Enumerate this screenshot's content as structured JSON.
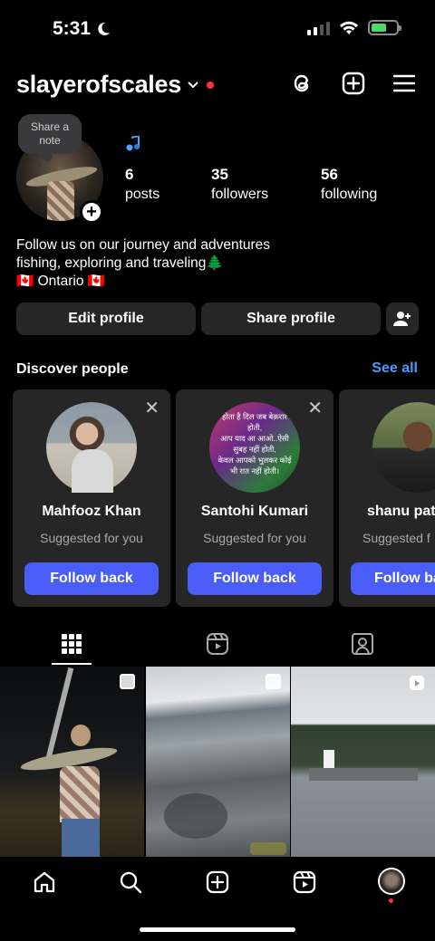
{
  "status_bar": {
    "time": "5:31"
  },
  "header": {
    "username": "slayerofscales"
  },
  "profile": {
    "note_label": "Share a\nnote",
    "stats": [
      {
        "value": "6",
        "label": "posts"
      },
      {
        "value": "35",
        "label": "followers"
      },
      {
        "value": "56",
        "label": "following"
      }
    ],
    "bio": [
      "Follow us on our journey and adventures",
      "fishing, exploring and traveling🌲",
      "🇨🇦 Ontario 🇨🇦"
    ],
    "edit_label": "Edit profile",
    "share_label": "Share profile"
  },
  "discover": {
    "title": "Discover people",
    "see_all": "See all",
    "cards": [
      {
        "name": "Mahfooz Khan",
        "sub": "Suggested for you",
        "action": "Follow back"
      },
      {
        "name": "Santohi Kumari",
        "sub": "Suggested for you",
        "action": "Follow back",
        "pic_text": "होता है दिल जब बेक़रार होती,\nआप याद आ आओ..ऐसी सुबह नहीं होती,\nकेवल आपको भुलकर कोई भी रात नहीं होती।"
      },
      {
        "name": "shanu pat",
        "sub": "Suggested f",
        "action": "Follow ba"
      }
    ]
  },
  "tabs": [
    "posts-grid",
    "reels",
    "tagged"
  ],
  "colors": {
    "accent": "#4a5df9",
    "link": "#4a9cff",
    "surface": "#262626"
  }
}
